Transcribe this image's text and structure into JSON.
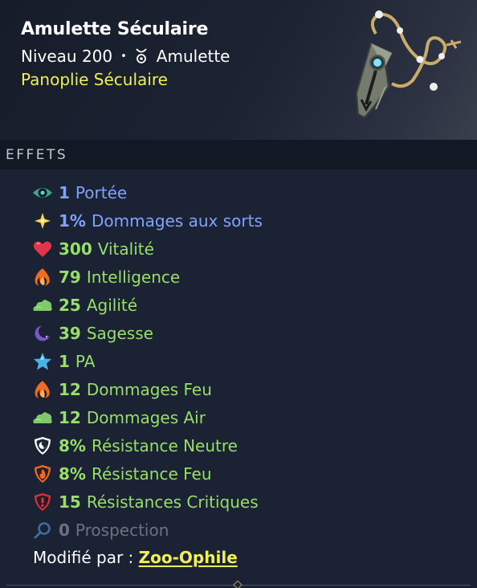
{
  "item": {
    "name": "Amulette Séculaire",
    "level": "Niveau 200",
    "separator": "•",
    "type": "Amulette",
    "set": "Panoplie Séculaire"
  },
  "effects_title": "EFFETS",
  "effects": [
    {
      "icon": "eye-icon",
      "value": "1",
      "label": "Portée",
      "color": "#7fa4ff"
    },
    {
      "icon": "star-sparkle-icon",
      "value": "1%",
      "label": "Dommages aux sorts",
      "color": "#7fa4ff"
    },
    {
      "icon": "heart-icon",
      "value": "300",
      "label": "Vitalité",
      "color": "#98de6a"
    },
    {
      "icon": "fire-icon",
      "value": "79",
      "label": "Intelligence",
      "color": "#98de6a"
    },
    {
      "icon": "cloud-icon",
      "value": "25",
      "label": "Agilité",
      "color": "#98de6a"
    },
    {
      "icon": "moon-icon",
      "value": "39",
      "label": "Sagesse",
      "color": "#98de6a"
    },
    {
      "icon": "star-icon",
      "value": "1",
      "label": "PA",
      "color": "#98de6a"
    },
    {
      "icon": "fire-icon",
      "value": "12",
      "label": "Dommages Feu",
      "color": "#98de6a"
    },
    {
      "icon": "cloud-icon",
      "value": "12",
      "label": "Dommages Air",
      "color": "#98de6a"
    },
    {
      "icon": "neutral-shield-icon",
      "value": "8%",
      "label": "Résistance Neutre",
      "color": "#98de6a"
    },
    {
      "icon": "fire-shield-icon",
      "value": "8%",
      "label": "Résistance Feu",
      "color": "#98de6a"
    },
    {
      "icon": "critical-shield-icon",
      "value": "15",
      "label": "Résistances Critiques",
      "color": "#98de6a"
    },
    {
      "icon": "magnifier-icon",
      "value": "0",
      "label": "Prospection",
      "color": "#6b7282"
    }
  ],
  "modified": {
    "label": "Modifié par :",
    "author": "Zoo-Ophile"
  }
}
